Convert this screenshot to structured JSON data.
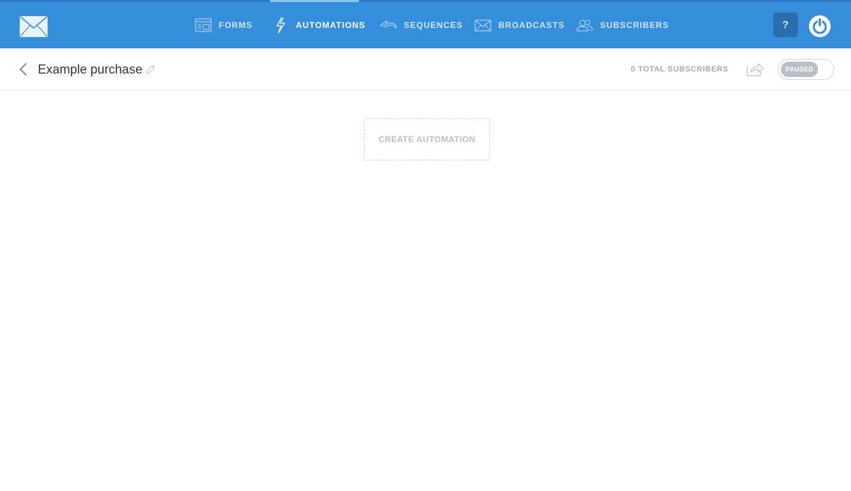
{
  "nav": {
    "items": [
      {
        "label": "FORMS",
        "icon": "forms-icon"
      },
      {
        "label": "AUTOMATIONS",
        "icon": "lightning-icon",
        "active": true
      },
      {
        "label": "SEQUENCES",
        "icon": "sequences-icon"
      },
      {
        "label": "BROADCASTS",
        "icon": "envelope-icon"
      },
      {
        "label": "SUBSCRIBERS",
        "icon": "users-icon"
      }
    ],
    "help_label": "?"
  },
  "automation": {
    "title": "Example purchase",
    "subscribers_label": "0 TOTAL SUBSCRIBERS",
    "status_label": "PAUSED"
  },
  "main": {
    "create_label": "CREATE AUTOMATION"
  },
  "colors": {
    "topbar": "#348ed9",
    "help_button": "#2a6fad",
    "active_indicator": "#8cc3ef"
  }
}
